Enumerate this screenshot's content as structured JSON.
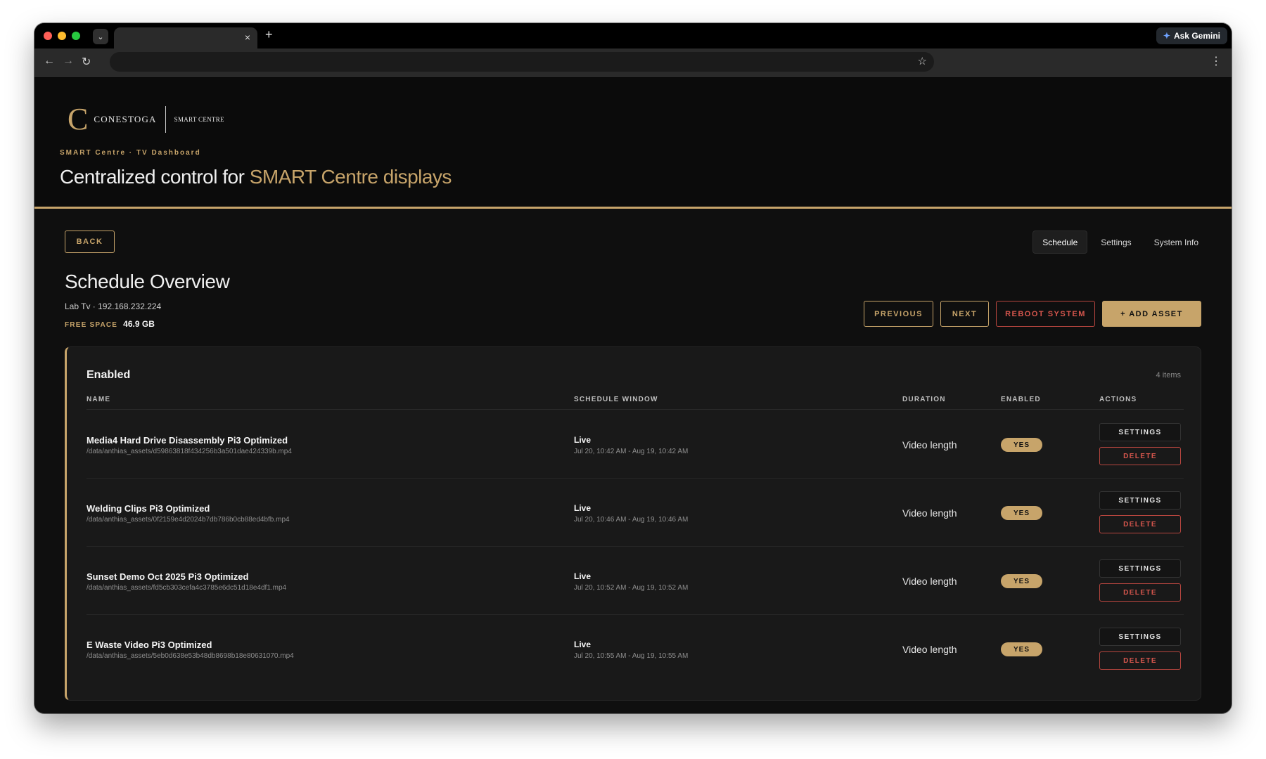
{
  "browser": {
    "gemini_label": "Ask Gemini",
    "new_tab_symbol": "+",
    "tab_close_symbol": "×"
  },
  "brand": {
    "logo_letter": "C",
    "logo_name": "CONESTOGA",
    "logo_sub": "SMART CENTRE"
  },
  "hero": {
    "eyebrow": "SMART Centre · TV Dashboard",
    "title_plain": "Centralized control for ",
    "title_accent": "SMART Centre displays"
  },
  "back_label": "BACK",
  "nav": {
    "schedule": "Schedule",
    "settings": "Settings",
    "system_info": "System Info"
  },
  "overview": {
    "title": "Schedule Overview",
    "subtitle": "Lab Tv · 192.168.232.224",
    "free_space_label": "FREE SPACE",
    "free_space_value": "46.9 GB"
  },
  "actions": {
    "previous": "PREVIOUS",
    "next": "NEXT",
    "reboot": "REBOOT SYSTEM",
    "add_asset": "+ ADD ASSET"
  },
  "table": {
    "title": "Enabled",
    "count": "4 items",
    "headers": {
      "name": "NAME",
      "window": "SCHEDULE WINDOW",
      "duration": "DURATION",
      "enabled": "ENABLED",
      "actions": "ACTIONS"
    },
    "rows": [
      {
        "name": "Media4 Hard Drive Disassembly Pi3 Optimized",
        "path": "/data/anthias_assets/d59863818f434256b3a501dae424339b.mp4",
        "status": "Live",
        "window": "Jul 20, 10:42 AM - Aug 19, 10:42 AM",
        "duration": "Video length",
        "enabled": "YES",
        "settings": "SETTINGS",
        "delete": "DELETE"
      },
      {
        "name": "Welding Clips Pi3 Optimized",
        "path": "/data/anthias_assets/0f2159e4d2024b7db786b0cb88ed4bfb.mp4",
        "status": "Live",
        "window": "Jul 20, 10:46 AM - Aug 19, 10:46 AM",
        "duration": "Video length",
        "enabled": "YES",
        "settings": "SETTINGS",
        "delete": "DELETE"
      },
      {
        "name": "Sunset Demo Oct 2025 Pi3 Optimized",
        "path": "/data/anthias_assets/fd5cb303cefa4c3785e6dc51d18e4df1.mp4",
        "status": "Live",
        "window": "Jul 20, 10:52 AM - Aug 19, 10:52 AM",
        "duration": "Video length",
        "enabled": "YES",
        "settings": "SETTINGS",
        "delete": "DELETE"
      },
      {
        "name": "E Waste Video Pi3 Optimized",
        "path": "/data/anthias_assets/5eb0d638e53b48db8698b18e80631070.mp4",
        "status": "Live",
        "window": "Jul 20, 10:55 AM - Aug 19, 10:55 AM",
        "duration": "Video length",
        "enabled": "YES",
        "settings": "SETTINGS",
        "delete": "DELETE"
      }
    ]
  },
  "colors": {
    "accent": "#c7a46a",
    "danger": "#d6564d",
    "background": "#0f0f0f"
  }
}
